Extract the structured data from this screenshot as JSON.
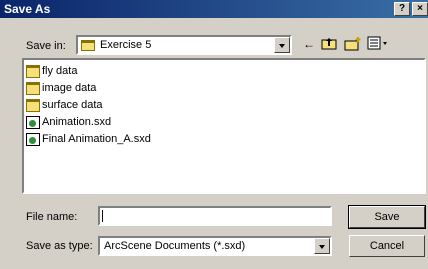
{
  "window": {
    "title": "Save As",
    "help_btn": "?",
    "close_btn": "×"
  },
  "save_in": {
    "label": "Save in:",
    "value": "Exercise 5"
  },
  "toolbar": {
    "back_icon": "back-arrow-icon",
    "up_icon": "up-folder-icon",
    "new_folder_icon": "new-folder-icon",
    "view_icon": "view-menu-icon"
  },
  "files": [
    {
      "name": "fly data",
      "type": "folder"
    },
    {
      "name": "image data",
      "type": "folder"
    },
    {
      "name": "surface data",
      "type": "folder"
    },
    {
      "name": "Animation.sxd",
      "type": "sxd"
    },
    {
      "name": "Final Animation_A.sxd",
      "type": "sxd"
    }
  ],
  "file_name": {
    "label": "File name:",
    "value": ""
  },
  "save_as_type": {
    "label": "Save as type:",
    "value": "ArcScene Documents (*.sxd)"
  },
  "buttons": {
    "save": "Save",
    "cancel": "Cancel"
  }
}
